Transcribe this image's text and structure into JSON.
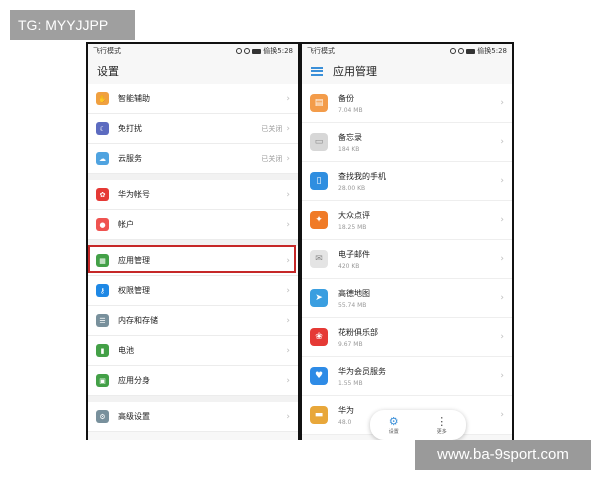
{
  "watermark": {
    "top": "TG: MYYJJPP",
    "bottom": "www.ba-9sport.com"
  },
  "left": {
    "status": {
      "mode": "飞行模式",
      "time": "偷换5:28"
    },
    "title": "设置",
    "items": [
      {
        "label": "智能辅助",
        "icon": "smart-assist-icon",
        "color": "#f0a040",
        "value": ""
      },
      {
        "label": "免打扰",
        "icon": "moon-icon",
        "color": "#5c6bc0",
        "value": "已关闭"
      },
      {
        "label": "云服务",
        "icon": "cloud-icon",
        "color": "#4fa3e0",
        "value": "已关闭"
      },
      {
        "label": "华为帐号",
        "icon": "huawei-account-icon",
        "color": "#e53935",
        "value": ""
      },
      {
        "label": "帐户",
        "icon": "account-icon",
        "color": "#ef5350",
        "value": ""
      },
      {
        "label": "应用管理",
        "icon": "app-manage-icon",
        "color": "#43a047",
        "value": ""
      },
      {
        "label": "权限管理",
        "icon": "key-icon",
        "color": "#1e88e5",
        "value": ""
      },
      {
        "label": "内存和存储",
        "icon": "storage-icon",
        "color": "#78909c",
        "value": ""
      },
      {
        "label": "电池",
        "icon": "battery-icon",
        "color": "#43a047",
        "value": ""
      },
      {
        "label": "应用分身",
        "icon": "app-twin-icon",
        "color": "#43a047",
        "value": ""
      },
      {
        "label": "高级设置",
        "icon": "gear-icon",
        "color": "#78909c",
        "value": ""
      }
    ]
  },
  "right": {
    "status": {
      "mode": "飞行模式",
      "time": "偷换5:28"
    },
    "title": "应用管理",
    "apps": [
      {
        "name": "备份",
        "size": "7.04 MB",
        "icon": "backup-icon",
        "color": "#f39c4a"
      },
      {
        "name": "备忘录",
        "size": "184 KB",
        "icon": "memo-icon",
        "color": "#d7d7d7"
      },
      {
        "name": "查找我的手机",
        "size": "28.00 KB",
        "icon": "find-phone-icon",
        "color": "#2f8ee0"
      },
      {
        "name": "大众点评",
        "size": "18.25 MB",
        "icon": "dianping-icon",
        "color": "#f07a26"
      },
      {
        "name": "电子邮件",
        "size": "420 KB",
        "icon": "mail-icon",
        "color": "#e4e4e4"
      },
      {
        "name": "高德地图",
        "size": "55.74 MB",
        "icon": "amap-icon",
        "color": "#3a9ee0"
      },
      {
        "name": "花粉俱乐部",
        "size": "9.67 MB",
        "icon": "huafen-icon",
        "color": "#e53935"
      },
      {
        "name": "华为会员服务",
        "size": "1.55 MB",
        "icon": "vip-icon",
        "color": "#2e8be6"
      },
      {
        "name": "华为",
        "size": "48.0",
        "icon": "wallet-icon",
        "color": "#e8a73a"
      }
    ],
    "bottom_bar": {
      "settings": "设置",
      "more": "更多"
    }
  }
}
